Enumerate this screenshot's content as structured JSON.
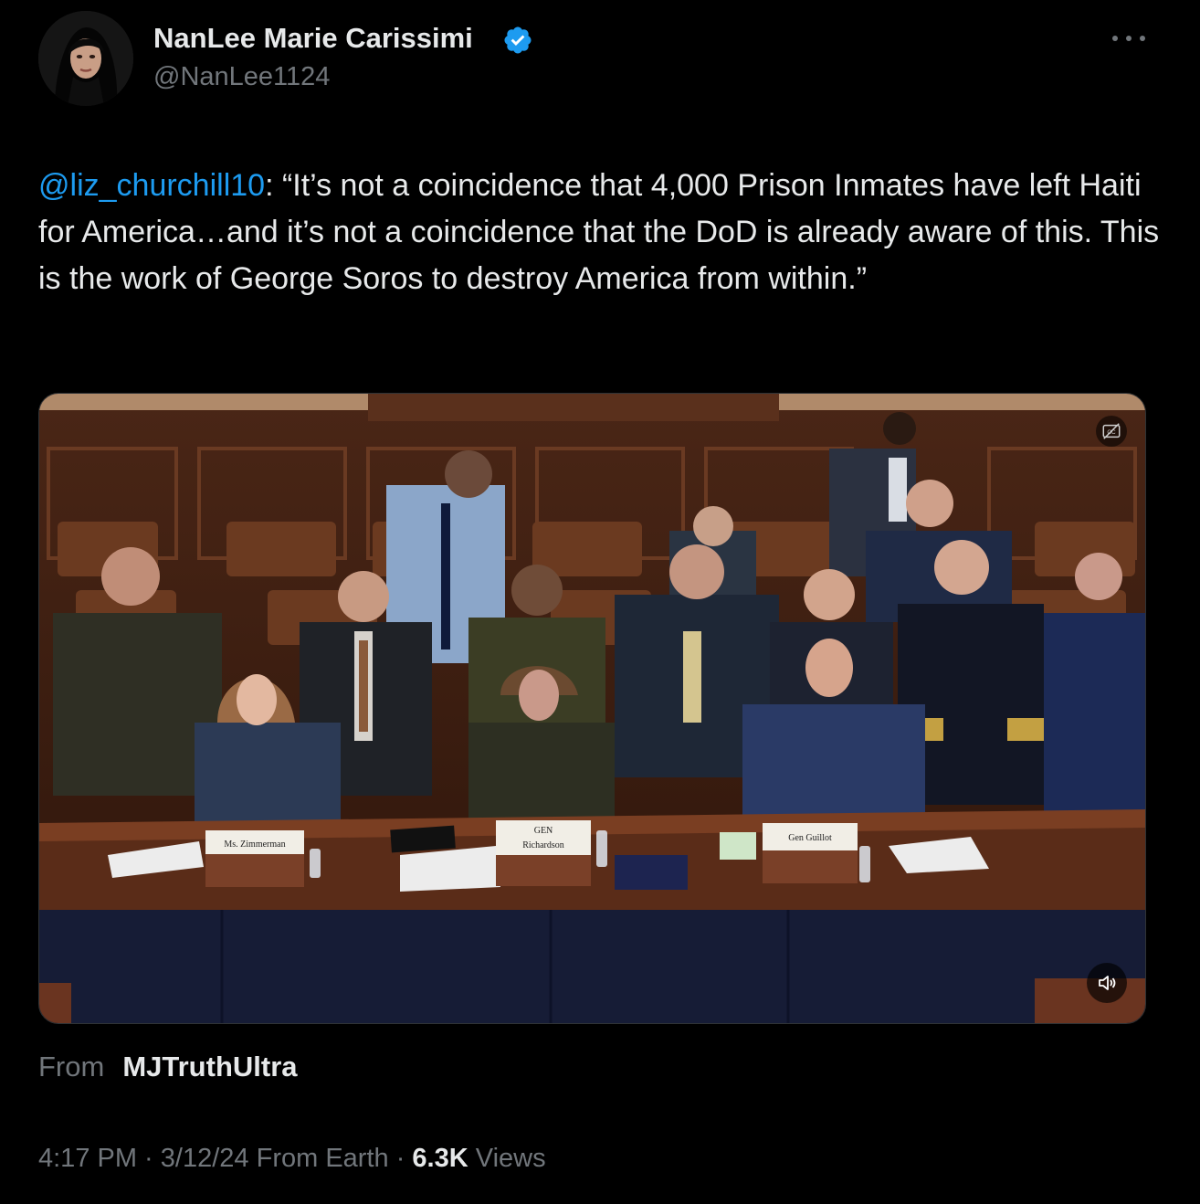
{
  "author": {
    "display_name": "NanLee Marie Carissimi",
    "handle": "@NanLee1124",
    "verified": true,
    "verified_icon": "verified-badge-icon",
    "accent_color": "#1d9bf0"
  },
  "tweet": {
    "mention": "@liz_churchill10",
    "text_after_mention": ": “It’s not a coincidence that 4,000 Prison Inmates have left Haiti for America…and it’s not a coincidence that the DoD is already aware of this. This is the work of George Soros to destroy America from within.”"
  },
  "media": {
    "type": "video",
    "nameplates": [
      "Ms. Zimmerman",
      "GEN",
      "Richardson",
      "Gen Guillot"
    ],
    "captions_icon": "closed-captions-icon",
    "mute_icon": "speaker-muted-icon"
  },
  "source": {
    "from_label": "From",
    "name": "MJTruthUltra"
  },
  "meta": {
    "time": "4:17 PM",
    "sep1": " · ",
    "date": "3/12/24",
    "client": " From Earth",
    "sep2": " · ",
    "views_count": "6.3K",
    "views_label": " Views"
  },
  "colors": {
    "background": "#000000",
    "text_primary": "#e7e9ea",
    "text_secondary": "#71767b",
    "link": "#1d9bf0"
  }
}
